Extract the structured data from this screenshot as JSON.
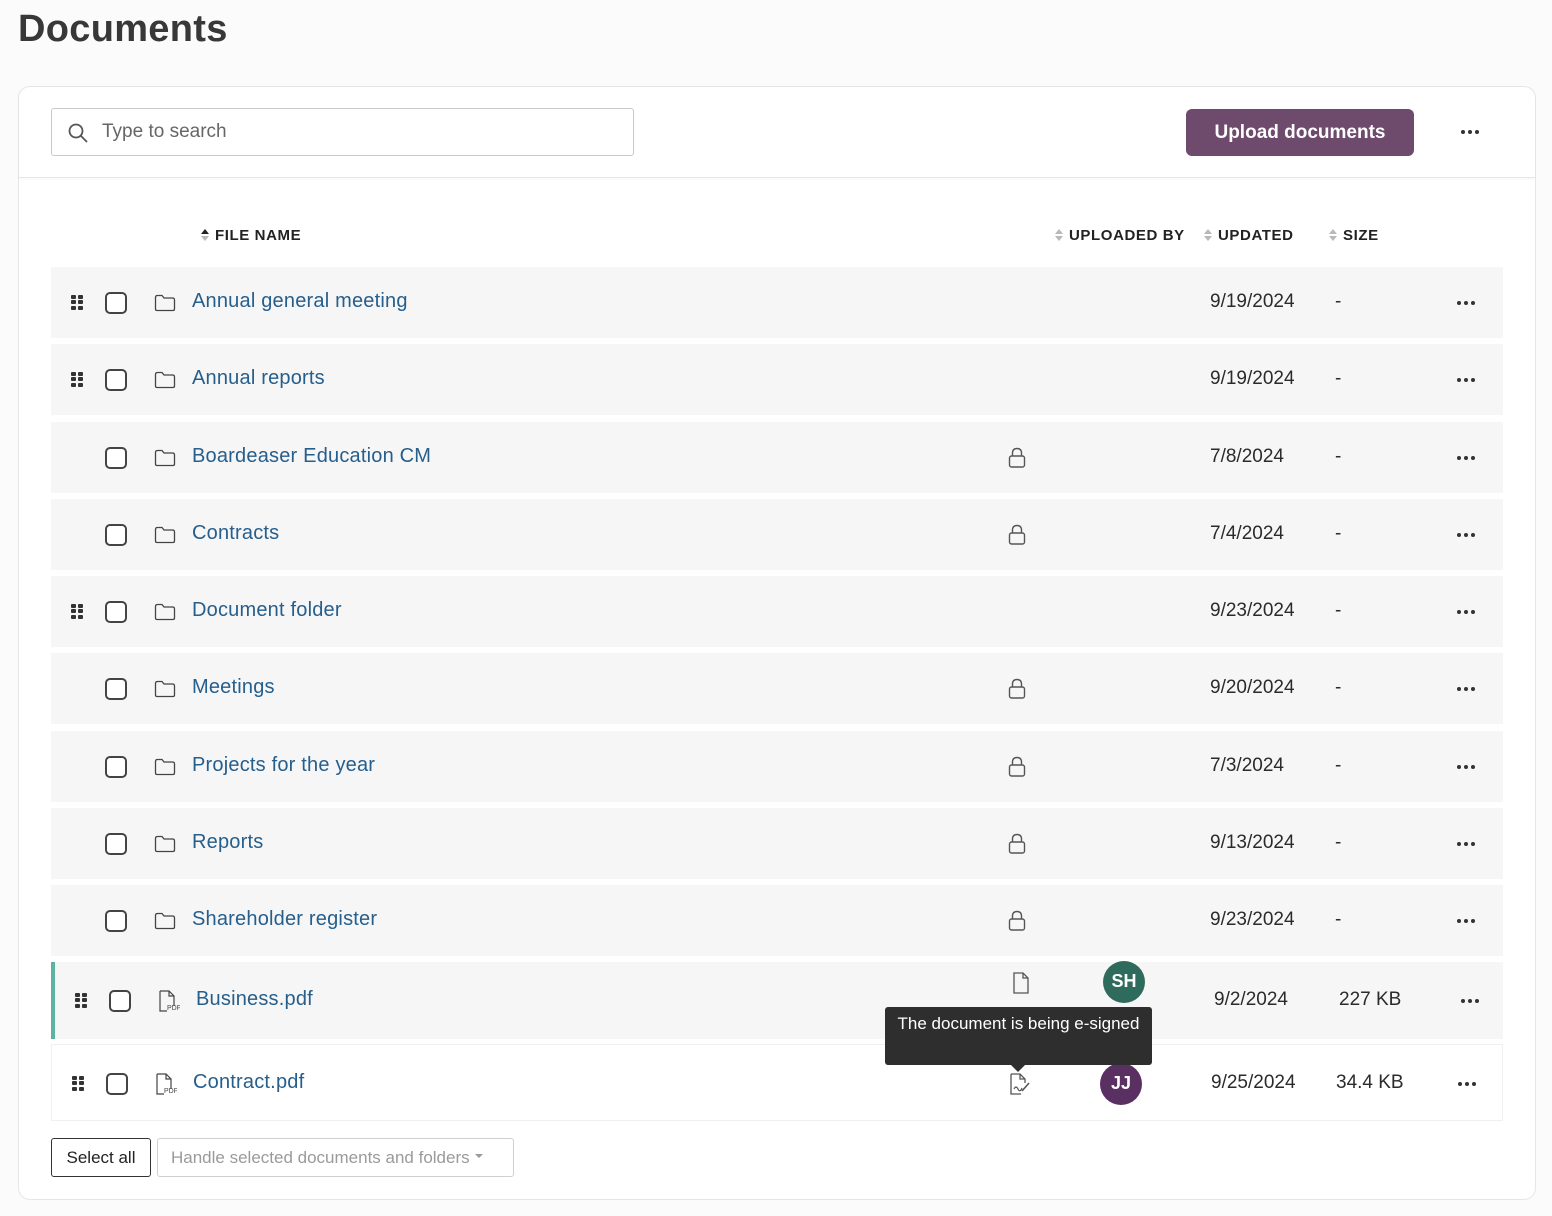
{
  "page": {
    "title": "Documents"
  },
  "toolbar": {
    "search_placeholder": "Type to search",
    "upload_label": "Upload documents"
  },
  "columns": {
    "file_name": "FILE NAME",
    "uploaded_by": "UPLOADED BY",
    "updated": "UPDATED",
    "size": "SIZE"
  },
  "rows": [
    {
      "name": "Annual general meeting",
      "type": "folder",
      "draggable": true,
      "locked": false,
      "updated": "9/19/2024",
      "size": "-"
    },
    {
      "name": "Annual reports",
      "type": "folder",
      "draggable": true,
      "locked": false,
      "updated": "9/19/2024",
      "size": "-"
    },
    {
      "name": "Boardeaser Education CM",
      "type": "folder",
      "draggable": false,
      "locked": true,
      "updated": "7/8/2024",
      "size": "-"
    },
    {
      "name": "Contracts",
      "type": "folder",
      "draggable": false,
      "locked": true,
      "updated": "7/4/2024",
      "size": "-"
    },
    {
      "name": "Document folder",
      "type": "folder",
      "draggable": true,
      "locked": false,
      "updated": "9/23/2024",
      "size": "-"
    },
    {
      "name": "Meetings",
      "type": "folder",
      "draggable": false,
      "locked": true,
      "updated": "9/20/2024",
      "size": "-"
    },
    {
      "name": "Projects for the year",
      "type": "folder",
      "draggable": false,
      "locked": true,
      "updated": "7/3/2024",
      "size": "-"
    },
    {
      "name": "Reports",
      "type": "folder",
      "draggable": false,
      "locked": true,
      "updated": "9/13/2024",
      "size": "-"
    },
    {
      "name": "Shareholder register",
      "type": "folder",
      "draggable": false,
      "locked": true,
      "updated": "9/23/2024",
      "size": "-"
    },
    {
      "name": "Business.pdf",
      "type": "pdf",
      "draggable": true,
      "status_icon": "document-icon",
      "uploaded_by": "SH",
      "avatar_color": "#2f6b5c",
      "updated": "9/2/2024",
      "size": "227 KB"
    },
    {
      "name": "Contract.pdf",
      "type": "pdf",
      "draggable": true,
      "status_icon": "e-sign-icon",
      "uploaded_by": "JJ",
      "avatar_color": "#5a2f62",
      "updated": "9/25/2024",
      "size": "34.4 KB"
    }
  ],
  "tooltip": {
    "text": "The document is being e-signed"
  },
  "footer": {
    "select_all_label": "Select all",
    "handle_label": "Handle selected documents and folders"
  },
  "colors": {
    "accent": "#6e4a6d",
    "link": "#265e8c",
    "row_highlight": "#5cb3a0"
  }
}
